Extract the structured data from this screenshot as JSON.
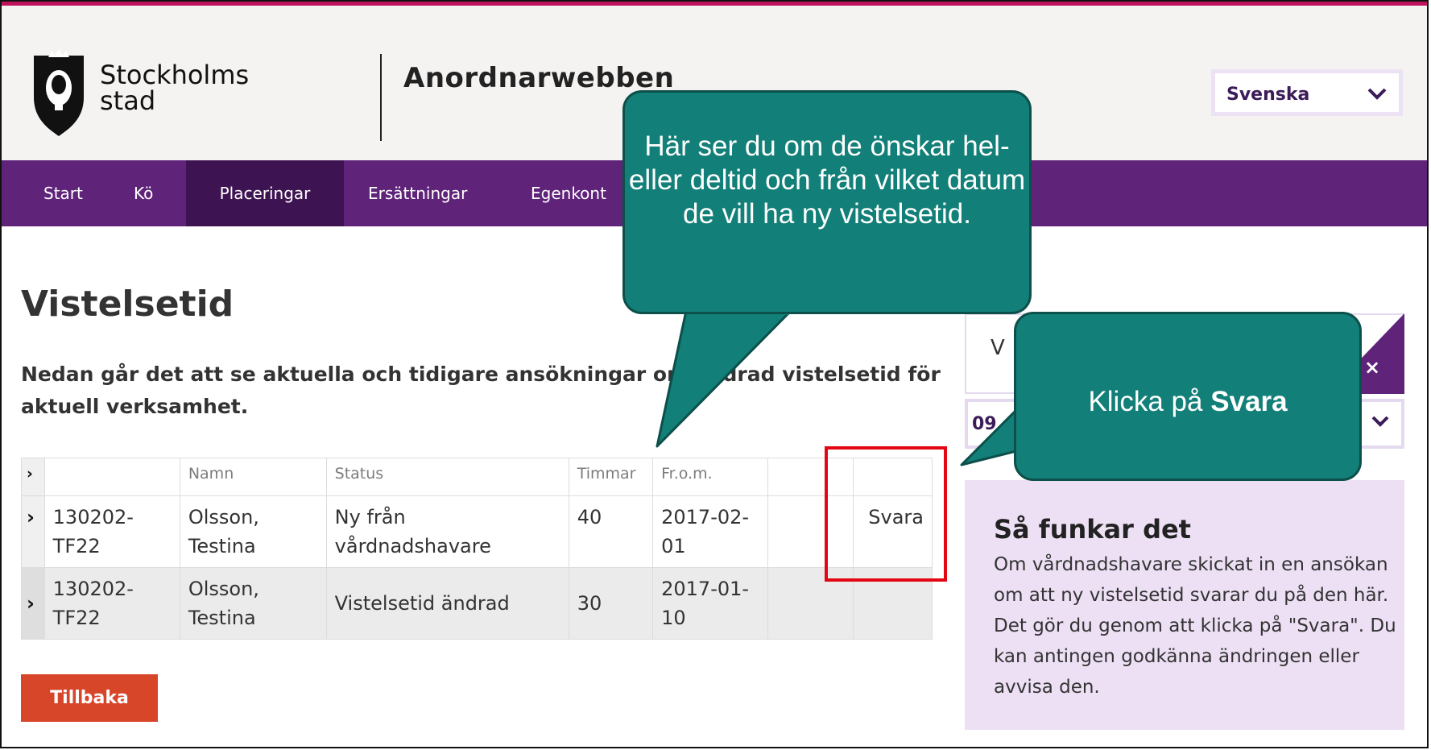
{
  "header": {
    "logo_text_line1": "Stockholms",
    "logo_text_line2": "stad",
    "app_title": "Anordnarwebben",
    "language_select": {
      "value": "Svenska"
    }
  },
  "nav": {
    "items": [
      {
        "label": "Start"
      },
      {
        "label": "Kö"
      },
      {
        "label": "Placeringar"
      },
      {
        "label": "Ersättningar"
      },
      {
        "label": "Egenkont"
      }
    ]
  },
  "main": {
    "page_title": "Vistelsetid",
    "intro_text": "Nedan går det att se aktuella och tidigare ansökningar om ändrad vistelsetid för aktuell verksamhet.",
    "table": {
      "headers": [
        "",
        "",
        "Namn",
        "Status",
        "Timmar",
        "Fr.o.m.",
        "",
        ""
      ],
      "rows": [
        {
          "id": "130202-TF22",
          "name": "Olsson, Testina",
          "status": "Ny från vårdnadshavare",
          "hours": "40",
          "from": "2017-02-01",
          "action": "Svara"
        },
        {
          "id": "130202-TF22",
          "name": "Olsson, Testina",
          "status": "Vistelsetid ändrad",
          "hours": "30",
          "from": "2017-01-10",
          "action": ""
        }
      ]
    },
    "back_button": "Tillbaka"
  },
  "sidebar": {
    "filter_partial_text": "V",
    "select_partial_value": "09",
    "info": {
      "title": "Så funkar det",
      "text": "Om vårdnadshavare skickat in en ansökan om att ny vistelsetid svarar du på den här. Det gör du genom att klicka på \"Svara\". Du kan antingen godkänna ändringen eller avvisa den."
    }
  },
  "callouts": {
    "bubble1": "Här ser du om de önskar hel- eller deltid och från vilket datum de vill ha ny vistelsetid.",
    "bubble2_prefix": "Klicka på ",
    "bubble2_bold": "Svara"
  },
  "colors": {
    "top_accent": "#c0135e",
    "nav_bg": "#5f2379",
    "nav_active": "#3e1352",
    "back_button": "#d8462a",
    "callout_bg": "#127f78",
    "highlight": "#e30613",
    "info_bg": "#ede0f5"
  }
}
